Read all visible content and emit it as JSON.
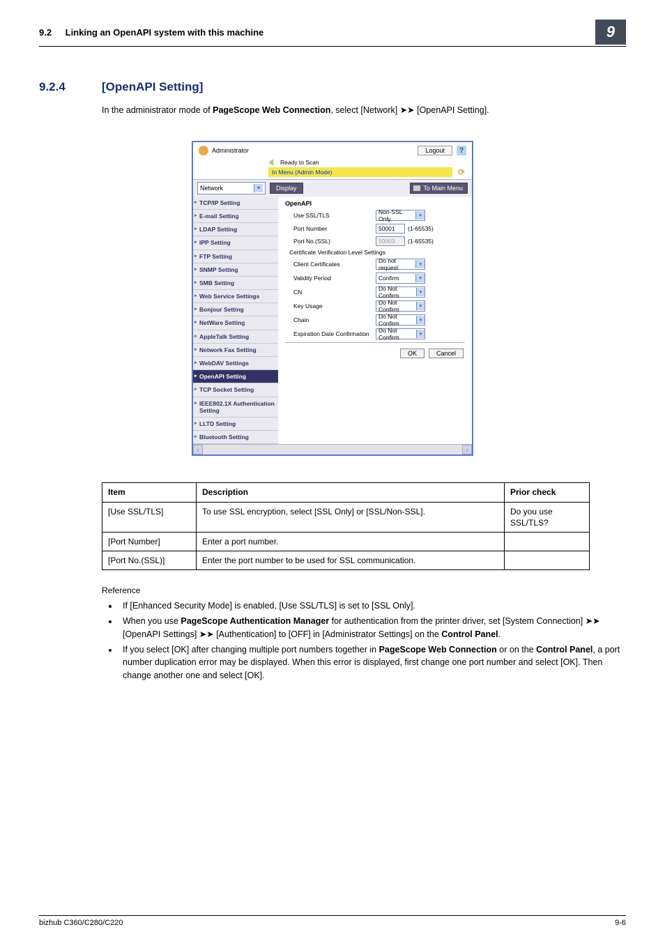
{
  "header": {
    "section_ref": "9.2",
    "section_label": "Linking an OpenAPI system with this machine",
    "chapter_badge": "9"
  },
  "section": {
    "number": "9.2.4",
    "title": "[OpenAPI Setting]",
    "intro_pre": "In the administrator mode of ",
    "intro_bold": "PageScope Web Connection",
    "intro_post": ", select [Network] ➤➤ [OpenAPI Setting]."
  },
  "shot": {
    "admin_label": "Administrator",
    "logout": "Logout",
    "help": "?",
    "status": "Ready to Scan",
    "mode": "In Menu (Admin Mode)",
    "nav_select": "Network",
    "display": "Display",
    "to_main": "To Main Menu",
    "sidebar": [
      "TCP/IP Setting",
      "E-mail Setting",
      "LDAP Setting",
      "IPP Setting",
      "FTP Setting",
      "SNMP Setting",
      "SMB Setting",
      "Web Service Settings",
      "Bonjour Setting",
      "NetWare Setting",
      "AppleTalk Setting",
      "Network Fax Setting",
      "WebDAV Settings",
      "OpenAPI Setting",
      "TCP Socket Setting",
      "IEEE802.1X Authentication Setting",
      "LLTD Setting",
      "Bluetooth Setting"
    ],
    "panel_title": "OpenAPI",
    "fields": {
      "use_ssl_label": "Use SSL/TLS",
      "use_ssl_value": "Non-SSL Only",
      "port_label": "Port Number",
      "port_value": "50001",
      "port_range": "(1-65535)",
      "port_ssl_label": "Port No.(SSL)",
      "port_ssl_value": "50003",
      "port_ssl_range": "(1-65535)",
      "cert_header": "Certificate Verification Level Settings",
      "client_cert_label": "Client Certificates",
      "client_cert_value": "Do not request",
      "validity_label": "Validity Period",
      "validity_value": "Confirm",
      "cn_label": "CN",
      "cn_value": "Do Not Confirm",
      "key_usage_label": "Key Usage",
      "key_usage_value": "Do Not Confirm",
      "chain_label": "Chain",
      "chain_value": "Do Not Confirm",
      "expiry_label": "Expiration Date Confirmation",
      "expiry_value": "Do Not Confirm"
    },
    "ok": "OK",
    "cancel": "Cancel"
  },
  "table": {
    "head_item": "Item",
    "head_desc": "Description",
    "head_prior": "Prior check",
    "rows": [
      {
        "item": "[Use SSL/TLS]",
        "desc": "To use SSL encryption, select [SSL Only] or [SSL/Non-SSL].",
        "prior": "Do you use SSL/TLS?"
      },
      {
        "item": "[Port Number]",
        "desc": "Enter a port number.",
        "prior": ""
      },
      {
        "item": "[Port No.(SSL)]",
        "desc": "Enter the port number to be used for SSL communication.",
        "prior": ""
      }
    ]
  },
  "reference_label": "Reference",
  "reference_items": [
    {
      "parts": [
        {
          "t": "If [Enhanced Security Mode] is enabled, [Use SSL/TLS] is set to [SSL Only]."
        }
      ]
    },
    {
      "parts": [
        {
          "t": "When you use "
        },
        {
          "t": "PageScope Authentication Manager",
          "b": true
        },
        {
          "t": " for authentication from the printer driver, set [System Connection] ➤➤ [OpenAPI Settings] ➤➤ [Authentication] to [OFF] in [Administrator Settings] on the "
        },
        {
          "t": "Control Panel",
          "b": true
        },
        {
          "t": "."
        }
      ]
    },
    {
      "parts": [
        {
          "t": "If you select [OK] after changing multiple port numbers together in "
        },
        {
          "t": "PageScope Web Connection",
          "b": true
        },
        {
          "t": " or on the "
        },
        {
          "t": "Control Panel",
          "b": true
        },
        {
          "t": ", a port number duplication error may be displayed. When this error is displayed, first change one port number and select [OK]. Then change another one and select [OK]."
        }
      ]
    }
  ],
  "footer": {
    "left": "bizhub C360/C280/C220",
    "right": "9-6"
  }
}
